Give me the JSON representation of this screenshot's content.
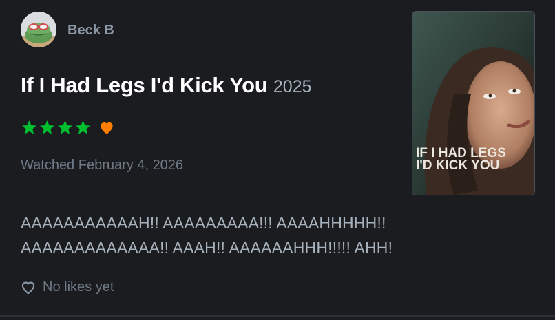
{
  "user": {
    "name": "Beck B",
    "avatar_icon": "frog-with-sunglasses-avatar"
  },
  "film": {
    "title": "If I Had Legs I'd Kick You",
    "year": "2025",
    "poster_title_lines": [
      "IF I HAD LEGS",
      "I'D KICK YOU"
    ]
  },
  "rating": {
    "stars": 4,
    "max_stars": 5,
    "liked": true,
    "star_color": "#00c030",
    "heart_color": "#ff8000"
  },
  "watched": "Watched February 4, 2026",
  "review": {
    "lines": [
      "AAAAAAAAAAAH!! AAAAAAAAA!!! AAAAHHHHH!!",
      "AAAAAAAAAAAAA!! AAAH!! AAAAAAHHH!!!!! AHH!"
    ]
  },
  "likes": {
    "text": "No likes yet",
    "icon": "heart-outline-icon"
  }
}
